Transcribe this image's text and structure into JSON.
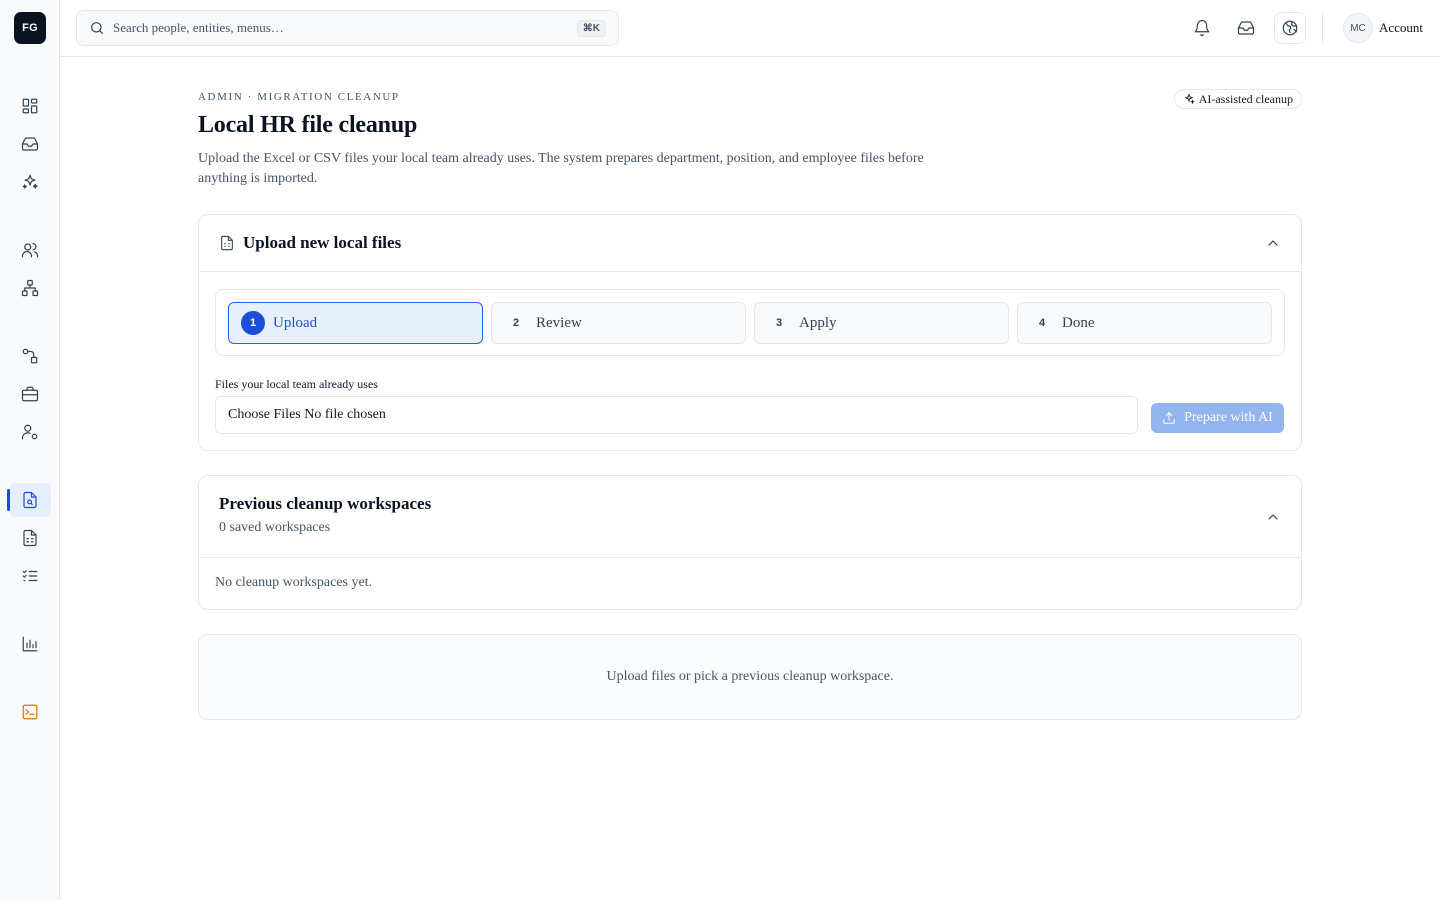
{
  "app": {
    "logo_text": "FG"
  },
  "sidebar": {
    "items": [
      {
        "icon": "dashboard-icon"
      },
      {
        "icon": "inbox-icon"
      },
      {
        "icon": "sparkles-icon"
      },
      {
        "icon": "people-icon"
      },
      {
        "icon": "org-chart-icon"
      },
      {
        "icon": "workflow-icon"
      },
      {
        "icon": "briefcase-icon"
      },
      {
        "icon": "user-settings-icon"
      },
      {
        "icon": "file-search-icon",
        "active": true
      },
      {
        "icon": "file-spreadsheet-icon"
      },
      {
        "icon": "checklist-icon"
      },
      {
        "icon": "bar-chart-icon"
      },
      {
        "icon": "terminal-icon",
        "color": "#d97706"
      }
    ]
  },
  "topbar": {
    "search_placeholder": "Search people, entities, menus…",
    "shortcut": "⌘K",
    "icons": [
      "bell-icon",
      "inbox-icon",
      "globe-icon"
    ],
    "account": {
      "initials": "MC",
      "label": "Account"
    }
  },
  "page": {
    "eyebrow": "ADMIN · MIGRATION CLEANUP",
    "badge": "AI-assisted cleanup",
    "title": "Local HR file cleanup",
    "description": "Upload the Excel or CSV files your local team already uses. The system prepares department, position, and employee files before anything is imported."
  },
  "upload_card": {
    "title": "Upload new local files",
    "steps": [
      {
        "num": "1",
        "label": "Upload",
        "active": true
      },
      {
        "num": "2",
        "label": "Review"
      },
      {
        "num": "3",
        "label": "Apply"
      },
      {
        "num": "4",
        "label": "Done"
      }
    ],
    "files_label": "Files your local team already uses",
    "file_input_text": "Choose Files No file chosen",
    "prepare_button": "Prepare with AI"
  },
  "previous_card": {
    "title": "Previous cleanup workspaces",
    "subtitle": "0 saved workspaces",
    "empty": "No cleanup workspaces yet."
  },
  "hint": "Upload files or pick a previous cleanup workspace.",
  "colors": {
    "accent": "#1d4ed8",
    "button_disabled": "#93b4ee",
    "warning": "#d97706"
  }
}
